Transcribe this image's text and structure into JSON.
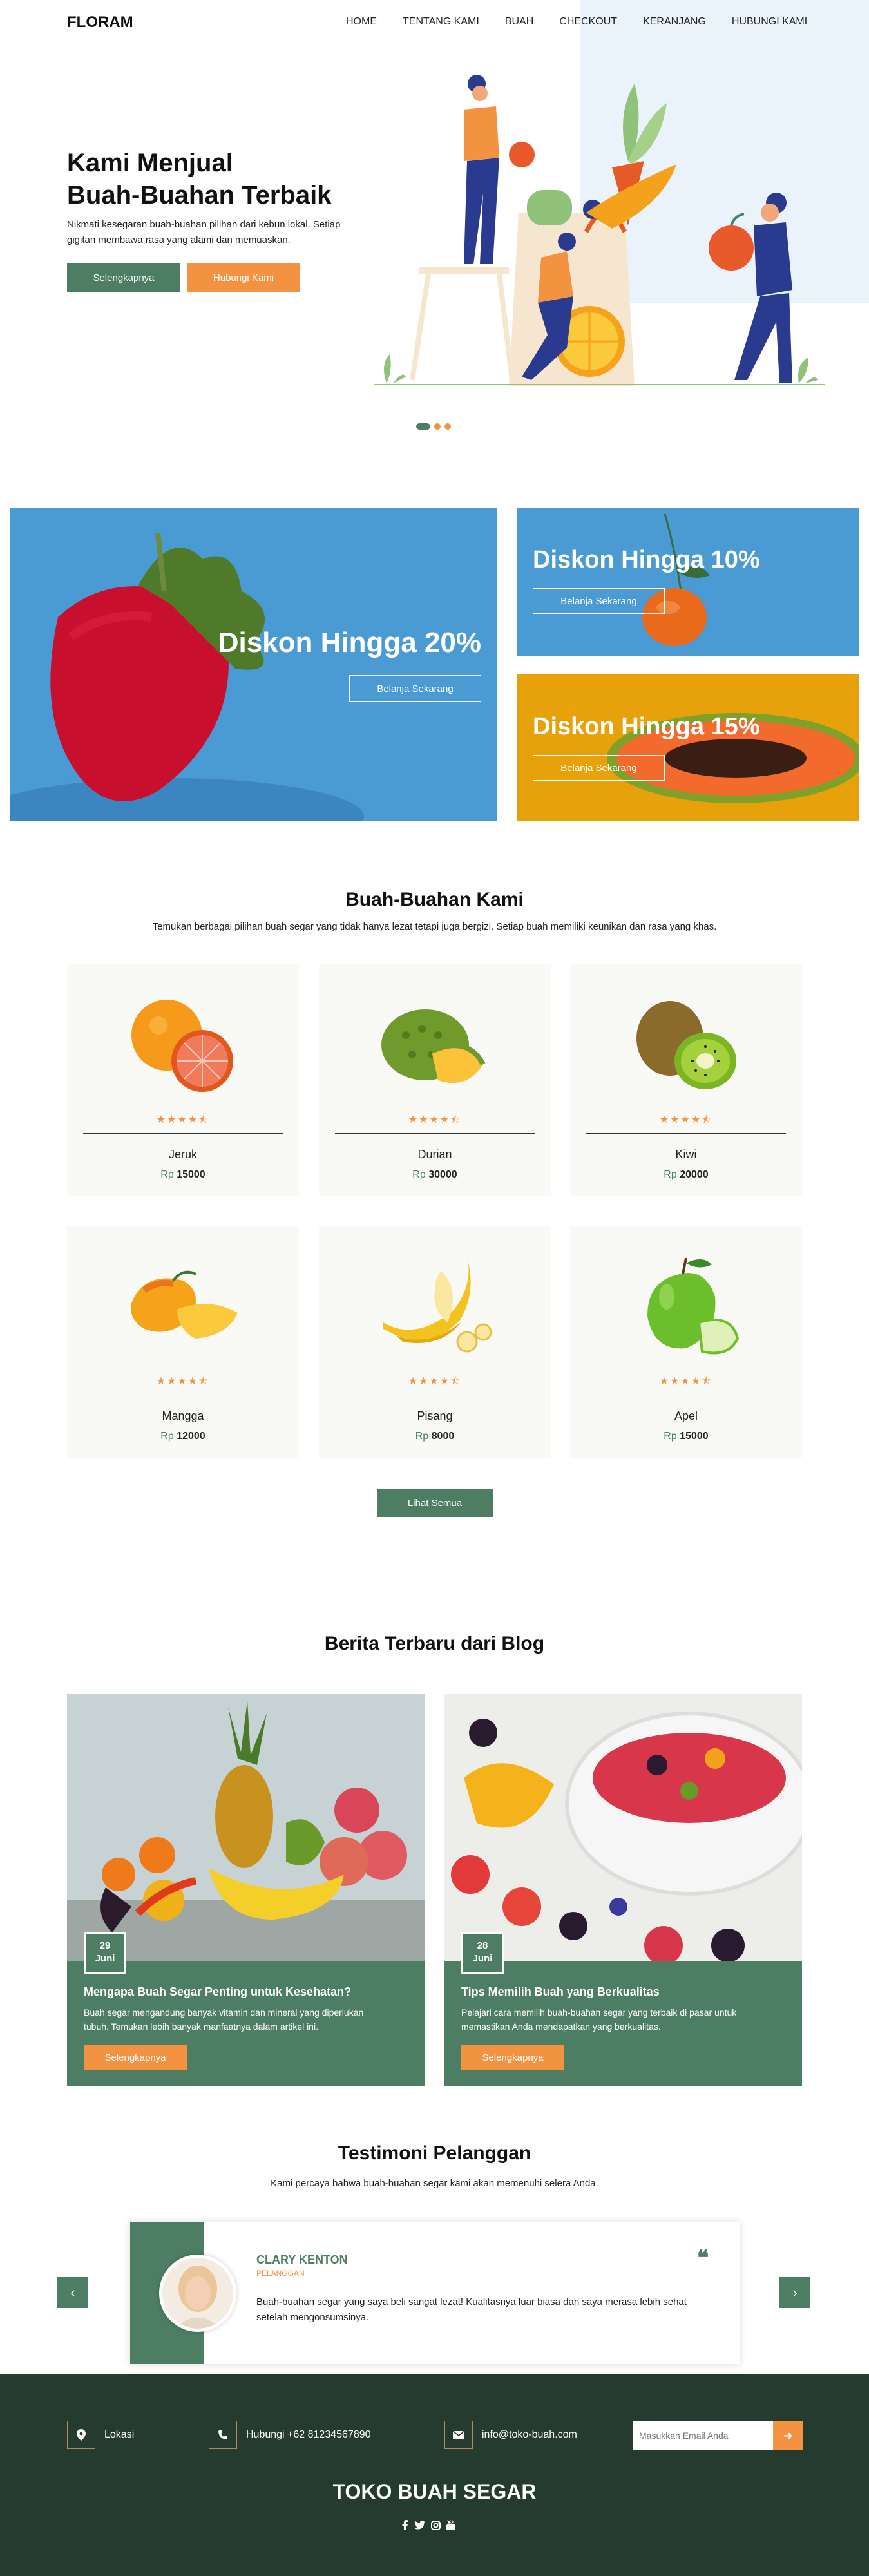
{
  "header": {
    "brand": "FLORAM",
    "nav": [
      "HOME",
      "TENTANG KAMI",
      "BUAH",
      "CHECKOUT",
      "KERANJANG",
      "HUBUNGI KAMI"
    ]
  },
  "hero": {
    "title_line1": "Kami Menjual",
    "title_line2": "Buah-Buahan Terbaik",
    "desc_line1": "Nikmati kesegaran buah-buahan pilihan dari kebun lokal. Setiap",
    "desc_line2": "gigitan membawa rasa yang alami dan memuaskan.",
    "btn_primary": "Selengkapnya",
    "btn_secondary": "Hubungi Kami",
    "slides": 3,
    "active_slide": 1
  },
  "promos": [
    {
      "title": "Diskon Hingga 20%",
      "button": "Belanja Sekarang"
    },
    {
      "title": "Diskon Hingga 10%",
      "button": "Belanja Sekarang"
    },
    {
      "title": "Diskon Hingga 15%",
      "button": "Belanja Sekarang"
    }
  ],
  "products": {
    "title": "Buah-Buahan Kami",
    "subtitle": "Temukan berbagai pilihan buah segar yang tidak hanya lezat tetapi juga bergizi. Setiap buah memiliki keunikan dan rasa yang khas.",
    "currency": "Rp",
    "items": [
      {
        "name": "Jeruk",
        "price": "15000",
        "rating": 4.5,
        "icon": "orange-icon"
      },
      {
        "name": "Durian",
        "price": "30000",
        "rating": 4.5,
        "icon": "durian-icon"
      },
      {
        "name": "Kiwi",
        "price": "20000",
        "rating": 4.5,
        "icon": "kiwi-icon"
      },
      {
        "name": "Mangga",
        "price": "12000",
        "rating": 4.5,
        "icon": "mango-icon"
      },
      {
        "name": "Pisang",
        "price": "8000",
        "rating": 4.5,
        "icon": "banana-icon"
      },
      {
        "name": "Apel",
        "price": "15000",
        "rating": 4.5,
        "icon": "apple-icon"
      }
    ],
    "view_all": "Lihat Semua"
  },
  "blog": {
    "title": "Berita Terbaru dari Blog",
    "posts": [
      {
        "day": "29",
        "month": "Juni",
        "title": "Mengapa Buah Segar Penting untuk Kesehatan?",
        "excerpt_line1": "Buah segar mengandung banyak vitamin dan mineral yang diperlukan",
        "excerpt_line2": "tubuh. Temukan lebih banyak manfaatnya dalam artikel ini.",
        "button": "Selengkapnya"
      },
      {
        "day": "28",
        "month": "Juni",
        "title": "Tips Memilih Buah yang Berkualitas",
        "excerpt_line1": "Pelajari cara memilih buah-buahan segar yang terbaik di pasar untuk",
        "excerpt_line2": "memastikan Anda mendapatkan yang berkualitas.",
        "button": "Selengkapnya"
      }
    ]
  },
  "testimonial": {
    "title": "Testimoni Pelanggan",
    "subtitle": "Kami percaya bahwa buah-buahan segar kami akan memenuhi selera Anda.",
    "name": "CLARY KENTON",
    "role": "PELANGGAN",
    "text_line1": "Buah-buahan segar yang saya beli sangat lezat! Kualitasnya luar biasa dan saya merasa lebih sehat",
    "text_line2": "setelah mengonsumsinya."
  },
  "footer": {
    "location": "Lokasi",
    "phone": "Hubungi +62 81234567890",
    "email": "info@toko-buah.com",
    "newsletter_placeholder": "Masukkan Email Anda",
    "brand": "TOKO BUAH SEGAR",
    "social": [
      "facebook-icon",
      "twitter-icon",
      "instagram-icon",
      "youtube-icon"
    ]
  },
  "colors": {
    "primary": "#4d7e63",
    "accent": "#f39241",
    "footer_bg": "#263b30",
    "promo_blue": "#4a9ad4",
    "promo_gold": "#e7a10b",
    "light_blue": "#eaf2fb",
    "card_bg": "#f9f9f5"
  }
}
